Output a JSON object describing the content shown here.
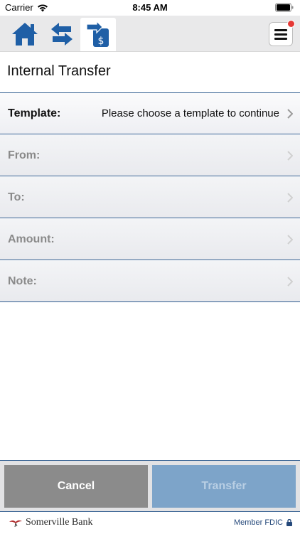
{
  "status_bar": {
    "carrier": "Carrier",
    "time": "8:45 AM"
  },
  "nav": {
    "icons": [
      "home-icon",
      "transfer-arrows-icon",
      "internal-transfer-icon"
    ],
    "active": "internal-transfer-icon",
    "menu_icon": "hamburger-menu-icon",
    "badge_color": "#e53935"
  },
  "page": {
    "title": "Internal Transfer"
  },
  "form": {
    "template": {
      "label": "Template:",
      "value": "Please choose a template to continue"
    },
    "from": {
      "label": "From:"
    },
    "to": {
      "label": "To:"
    },
    "amount": {
      "label": "Amount:"
    },
    "note": {
      "label": "Note:"
    }
  },
  "actions": {
    "cancel": "Cancel",
    "transfer": "Transfer"
  },
  "footer": {
    "brand": "Somerville Bank",
    "fdic": "Member FDIC"
  },
  "colors": {
    "brand_blue": "#1f5fa6",
    "divider": "#2f5c8f"
  }
}
